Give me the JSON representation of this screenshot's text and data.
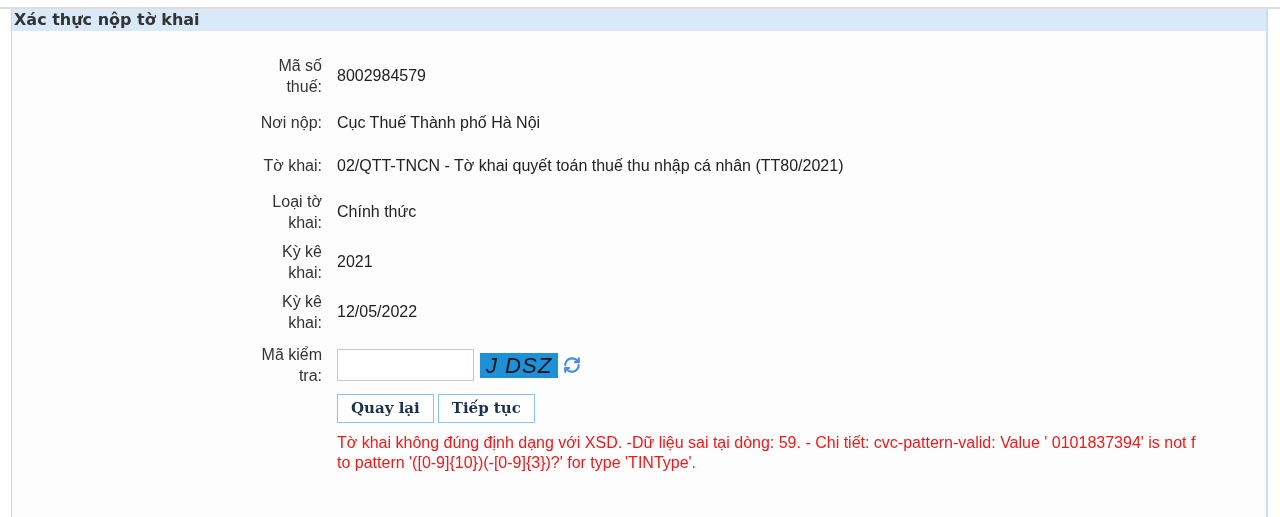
{
  "panel": {
    "title": "Xác thực nộp tờ khai"
  },
  "fields": [
    {
      "label": "Mã số thuế:",
      "value": "8002984579"
    },
    {
      "label": "Nơi nộp:",
      "value": "Cục Thuế Thành phố Hà Nội"
    },
    {
      "label": "Tờ khai:",
      "value": "02/QTT-TNCN - Tờ khai quyết toán thuế thu nhập cá nhân (TT80/2021)"
    },
    {
      "label": "Loại tờ khai:",
      "value": "Chính thức"
    },
    {
      "label": "Kỳ kê khai:",
      "value": "2021"
    },
    {
      "label": "Kỳ kê khai:",
      "value": "12/05/2022"
    }
  ],
  "captcha": {
    "label": "Mã kiểm tra:",
    "code": "J DSZ"
  },
  "buttons": [
    "Quay lại",
    "Tiếp tục"
  ],
  "error_lines": [
    "Tờ khai không đúng định dạng với XSD. -Dữ liệu sai tại dòng: 59. - Chi tiết: cvc-pattern-valid: Value ' 0101837394' is not f",
    "to pattern '([0-9]{10})(-[0-9]{3})?' for type 'TINType'."
  ]
}
